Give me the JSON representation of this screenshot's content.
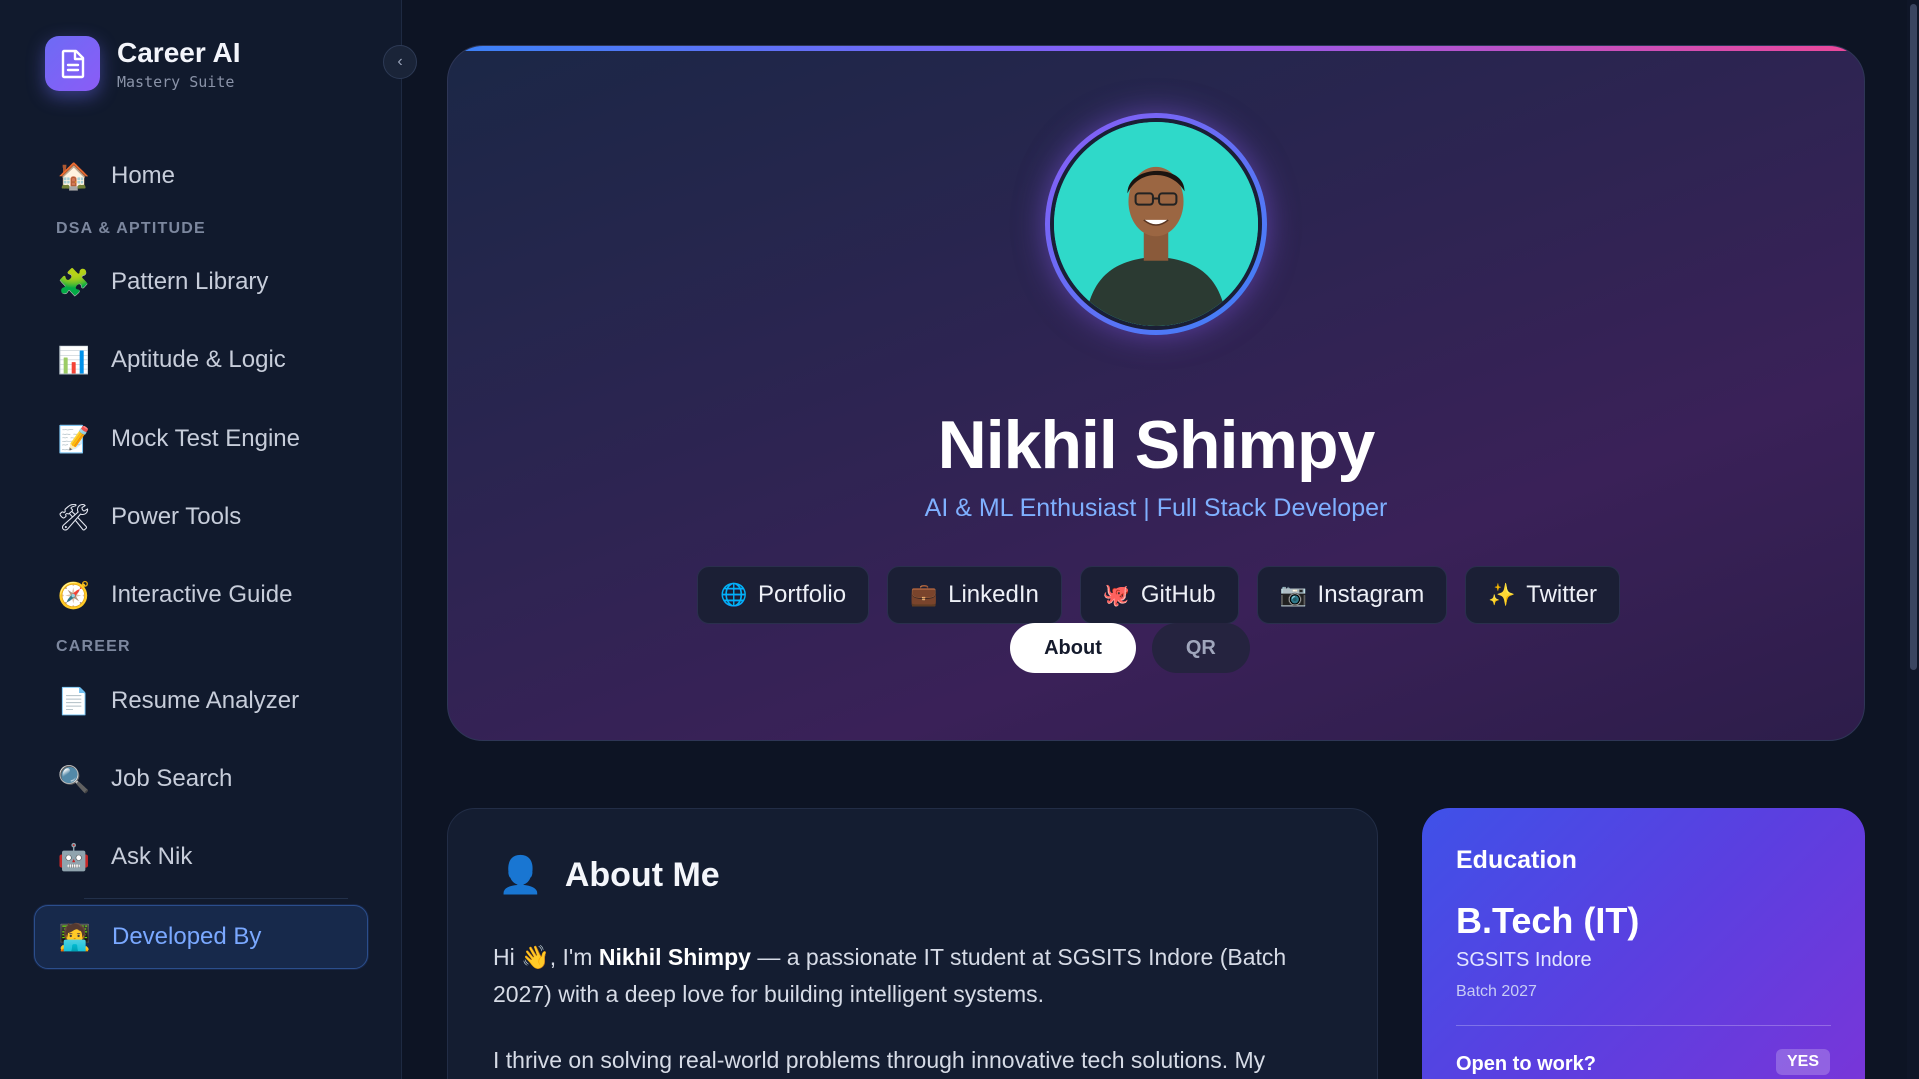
{
  "sidebar": {
    "brand": {
      "title": "Career AI",
      "subtitle": "Mastery Suite",
      "logo_icon": "document-icon"
    },
    "collapse_icon": "chevron-left-icon",
    "items": [
      {
        "label": "Home",
        "icon": "house-icon"
      },
      {
        "section": "DSA & APTITUDE"
      },
      {
        "label": "Pattern Library",
        "icon": "puzzle-icon"
      },
      {
        "label": "Aptitude & Logic",
        "icon": "bar-chart-icon"
      },
      {
        "label": "Mock Test Engine",
        "icon": "memo-icon"
      },
      {
        "label": "Power Tools",
        "icon": "tools-icon"
      },
      {
        "label": "Interactive Guide",
        "icon": "compass-icon"
      },
      {
        "section": "CAREER"
      },
      {
        "label": "Resume Analyzer",
        "icon": "page-icon"
      },
      {
        "label": "Job Search",
        "icon": "magnifier-icon"
      },
      {
        "label": "Ask Nik",
        "icon": "robot-icon"
      },
      {
        "label": "Developed By",
        "icon": "developer-icon",
        "active": true
      }
    ]
  },
  "hero": {
    "name": "Nikhil Shimpy",
    "role": "AI & ML Enthusiast | Full Stack Developer",
    "links": [
      {
        "label": "Portfolio",
        "icon": "globe-icon"
      },
      {
        "label": "LinkedIn",
        "icon": "briefcase-icon"
      },
      {
        "label": "GitHub",
        "icon": "octopus-icon"
      },
      {
        "label": "Instagram",
        "icon": "camera-icon"
      },
      {
        "label": "Twitter",
        "icon": "sparkles-icon"
      }
    ],
    "tabs": [
      {
        "label": "About",
        "active": true
      },
      {
        "label": "QR",
        "active": false
      }
    ]
  },
  "about": {
    "title": "About Me",
    "icon": "person-icon",
    "p1_a": "Hi 👋, I'm ",
    "p1_name": "Nikhil Shimpy",
    "p1_b": " — a passionate IT student at SGSITS Indore (Batch 2027) with a deep love for building intelligent systems.",
    "p2": "I thrive on solving real-world problems through innovative tech solutions. My"
  },
  "education": {
    "title": "Education",
    "degree": "B.Tech (IT)",
    "school": "SGSITS Indore",
    "batch": "Batch 2027",
    "open_label": "Open to work?",
    "open_value": "YES"
  },
  "colors": {
    "accent": "#7aa8ff",
    "brand_gradient_start": "#6d6bf5",
    "hero_gradient_end": "#3a2158",
    "education_gradient": "#5b3fe0"
  }
}
